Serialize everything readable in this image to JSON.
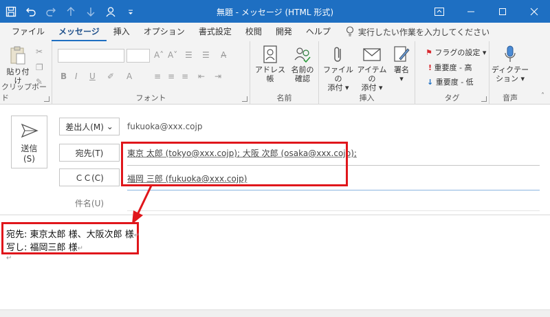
{
  "title": "無題 - メッセージ (HTML 形式)",
  "menu": {
    "tabs": [
      "ファイル",
      "メッセージ",
      "挿入",
      "オプション",
      "書式設定",
      "校閲",
      "開発",
      "ヘルプ"
    ],
    "active_tab": "メッセージ",
    "tell_me": "実行したい作業を入力してください"
  },
  "ribbon": {
    "clipboard": {
      "paste": "貼り付け",
      "label": "クリップボード"
    },
    "font": {
      "label": "フォント"
    },
    "names": {
      "address_book": "アドレス帳",
      "check_names_1": "名前の",
      "check_names_2": "確認",
      "label": "名前"
    },
    "insert": {
      "attach_file_1": "ファイルの",
      "attach_file_2": "添付",
      "attach_item_1": "アイテムの",
      "attach_item_2": "添付",
      "signature": "署名",
      "label": "挿入"
    },
    "tags": {
      "follow_up": "フラグの設定",
      "high": "重要度 - 高",
      "low": "重要度 - 低",
      "label": "タグ"
    },
    "voice": {
      "dictate_1": "ディクテー",
      "dictate_2": "ション",
      "label": "音声"
    }
  },
  "compose": {
    "send_1": "送信",
    "send_2": "(S)",
    "from_button": "差出人(M)",
    "from_value": "fukuoka@xxx.cojp",
    "to_button": "宛先(T)",
    "to_value": "東京 太郎 (tokyo@xxx.cojp); 大阪 次郎 (osaka@xxx.cojp);",
    "cc_button": "ＣＣ(C)",
    "cc_value": "福岡 三郎 (fukuoka@xxx.cojp)",
    "subject_label": "件名(U)"
  },
  "body": {
    "line1": "宛先: 東京太郎 様、大阪次郎 様",
    "line2": "写し: 福岡三郎 様"
  },
  "colors": {
    "titlebar": "#1e6fc2",
    "annotation": "#e0161b"
  }
}
